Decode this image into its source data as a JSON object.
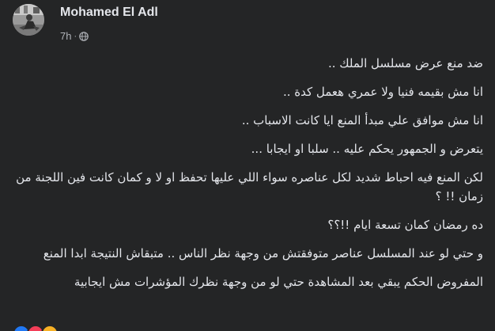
{
  "post": {
    "author": "Mohamed El Adl",
    "time": "7h",
    "separator": "·",
    "privacy_icon": "globe-icon",
    "paragraphs": [
      "ضد منع  عرض مسلسل الملك ..",
      "انا مش بقيمه فنيا ولا عمري هعمل كدة ..",
      "انا مش موافق علي مبدأ المنع ايا كانت الاسباب ..",
      "يتعرض و الجمهور يحكم عليه .. سلبا او ايجابا ...",
      "لكن المنع فيه احباط شديد لكل عناصره سواء اللي عليها تحفظ او لا و كمان كانت فين اللجنة من زمان !! ؟",
      "ده رمضان كمان تسعة ايام !!؟؟",
      "و حتي لو عند المسلسل عناصر متوفقتش من وجهة نظر الناس .. متبقاش النتيجة ابدا المنع",
      "المفروض الحكم يبقي بعد المشاهدة حتي لو من وجهة نظرك المؤشرات مش ايجابية"
    ],
    "reaction_icons": [
      "like-icon",
      "love-icon",
      "haha-icon"
    ]
  },
  "colors": {
    "background": "#242526",
    "primary_text": "#e4e6eb",
    "secondary_text": "#b0b3b8"
  }
}
